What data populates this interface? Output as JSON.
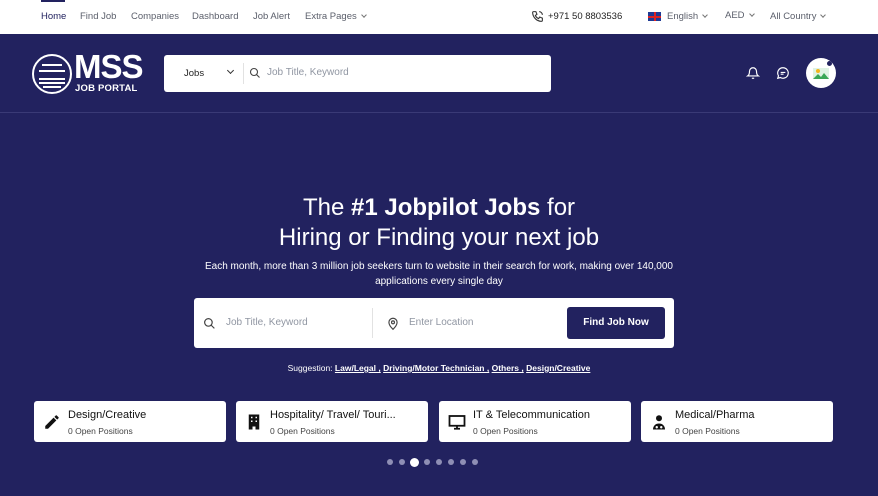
{
  "topnav": {
    "links": [
      "Home",
      "Find Job",
      "Companies",
      "Dashboard",
      "Job Alert",
      "Extra Pages"
    ],
    "phone": "+971 50 8803536",
    "language": "English",
    "currency": "AED",
    "country": "All Country"
  },
  "header": {
    "logo_text": "MSS",
    "logo_sub": "JOB PORTAL",
    "search_category": "Jobs",
    "search_placeholder": "Job Title, Keyword",
    "icons": [
      "bell-icon",
      "chat-icon",
      "avatar"
    ]
  },
  "hero": {
    "title_pre": "The ",
    "title_bold": "#1 Jobpilot Jobs",
    "title_post": " for",
    "title_line2": "Hiring or Finding your next job",
    "subtitle": "Each month, more than 3 million job seekers turn to website in their search for work, making over 140,000 applications every single day",
    "keyword_placeholder": "Job Title, Keyword",
    "location_placeholder": "Enter Location",
    "button": "Find Job Now",
    "suggestion_label": "Suggestion:",
    "suggestions": [
      "Law/Legal ,",
      "Driving/Motor Technician ,",
      "Others ,",
      "Design/Creative"
    ]
  },
  "categories": [
    {
      "title": "Design/Creative",
      "positions": "0 Open Positions",
      "icon": "pen-icon"
    },
    {
      "title": "Hospitality/ Travel/ Touri...",
      "positions": "0 Open Positions",
      "icon": "hotel-icon"
    },
    {
      "title": "IT & Telecommunication",
      "positions": "0 Open Positions",
      "icon": "monitor-icon"
    },
    {
      "title": "Medical/Pharma",
      "positions": "0 Open Positions",
      "icon": "doctor-icon"
    }
  ],
  "carousel": {
    "total": 8,
    "active": 3
  },
  "colors": {
    "brand": "#22225f",
    "white": "#ffffff"
  }
}
